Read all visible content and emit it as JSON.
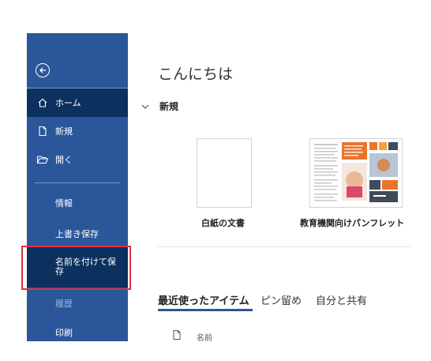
{
  "sidebar": {
    "home": "ホーム",
    "new": "新規",
    "open": "開く",
    "info": "情報",
    "overwrite_save": "上書き保存",
    "save_as": "名前を付けて保存",
    "history": "履歴",
    "print": "印刷"
  },
  "main": {
    "greeting": "こんにちは",
    "new_section": "新規",
    "templates": [
      {
        "label": "白紙の文書"
      },
      {
        "label": "教育機関向けパンフレット"
      }
    ],
    "tabs": [
      "最近使ったアイテム",
      "ピン留め",
      "自分と共有"
    ],
    "list_header": "名前"
  },
  "colors": {
    "sidebar_bg": "#2b579a",
    "sidebar_selected": "#0d315f",
    "highlight": "#e0303a"
  }
}
